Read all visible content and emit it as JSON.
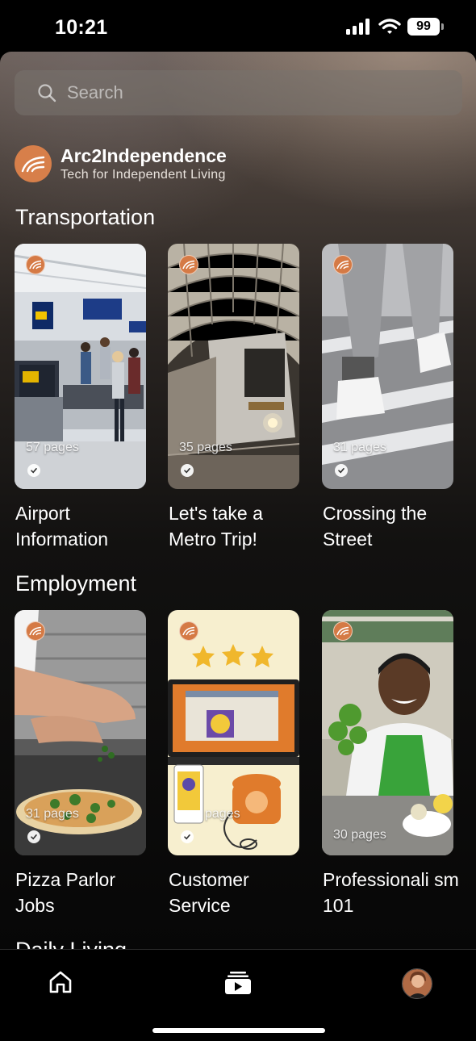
{
  "status_bar": {
    "time": "10:21",
    "battery": "99"
  },
  "search": {
    "placeholder": "Search"
  },
  "brand": {
    "name": "Arc2Independence",
    "tagline": "Tech for Independent Living"
  },
  "sections": [
    {
      "title": "Transportation",
      "cards": [
        {
          "title": "Airport Information",
          "pages": "57 pages"
        },
        {
          "title": "Let's take a Metro Trip!",
          "pages": "35 pages"
        },
        {
          "title": "Crossing the Street",
          "pages": "31 pages"
        }
      ]
    },
    {
      "title": "Employment",
      "cards": [
        {
          "title": "Pizza Parlor Jobs",
          "pages": "31 pages"
        },
        {
          "title": "Customer Service",
          "pages": "pages"
        },
        {
          "title": "Professionali sm 101",
          "pages": "30 pages"
        }
      ]
    },
    {
      "title": "Daily Living"
    }
  ],
  "tab_bar": {
    "items": [
      "home-icon",
      "library-icon",
      "profile-avatar"
    ]
  },
  "colors": {
    "accent": "#D77F4A",
    "background": "#000000"
  }
}
